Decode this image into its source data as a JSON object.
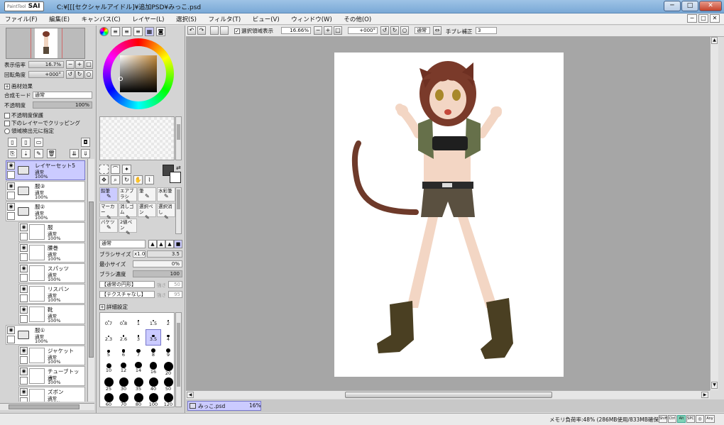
{
  "titlebar": {
    "logo": "SAI",
    "logo_sub": "PaintTool",
    "title": "C:¥[[[セクシャルアイドル]¥追加PSD¥みっこ.psd",
    "min": "─",
    "max": "□",
    "close": "✕"
  },
  "menu": [
    "ファイル(F)",
    "編集(E)",
    "キャンバス(C)",
    "レイヤー(L)",
    "選択(S)",
    "フィルタ(T)",
    "ビュー(V)",
    "ウィンドウ(W)",
    "その他(O)"
  ],
  "navigator": {
    "zoom_label": "表示倍率",
    "zoom_value": "16.7%",
    "angle_label": "回転角度",
    "angle_value": "+000°"
  },
  "layerprops": {
    "texture_label": "画材効果",
    "blend_label": "合成モード",
    "blend_value": "通常",
    "opacity_label": "不透明度",
    "opacity_value": "100%",
    "cb1": "不透明度保護",
    "cb2": "下のレイヤーでクリッピング",
    "cb3": "領域検出元に指定"
  },
  "layers": [
    {
      "name": "レイヤーセット5",
      "mode": "通常",
      "opacity": "100%",
      "folder": true,
      "selected": true,
      "indent": 0
    },
    {
      "name": "服③",
      "mode": "通常",
      "opacity": "100%",
      "folder": true,
      "selected": false,
      "indent": 0
    },
    {
      "name": "服②",
      "mode": "通常",
      "opacity": "100%",
      "folder": true,
      "selected": false,
      "indent": 0
    },
    {
      "name": "服",
      "mode": "通常",
      "opacity": "100%",
      "folder": false,
      "selected": false,
      "indent": 1
    },
    {
      "name": "腰巻",
      "mode": "通常",
      "opacity": "100%",
      "folder": false,
      "selected": false,
      "indent": 1
    },
    {
      "name": "スパッツ",
      "mode": "通常",
      "opacity": "100%",
      "folder": false,
      "selected": false,
      "indent": 1
    },
    {
      "name": "リスバン",
      "mode": "通常",
      "opacity": "100%",
      "folder": false,
      "selected": false,
      "indent": 1
    },
    {
      "name": "靴",
      "mode": "通常",
      "opacity": "100%",
      "folder": false,
      "selected": false,
      "indent": 1
    },
    {
      "name": "服①",
      "mode": "通常",
      "opacity": "100%",
      "folder": true,
      "selected": false,
      "indent": 0
    },
    {
      "name": "ジャケット",
      "mode": "通常",
      "opacity": "100%",
      "folder": false,
      "selected": false,
      "indent": 1
    },
    {
      "name": "チューブトップ",
      "mode": "通常",
      "opacity": "100%",
      "folder": false,
      "selected": false,
      "indent": 1
    },
    {
      "name": "ズボン",
      "mode": "通常",
      "opacity": "100%",
      "folder": false,
      "selected": false,
      "indent": 1
    }
  ],
  "tools": [
    {
      "label": "鉛筆",
      "selected": true
    },
    {
      "label": "エアブラシ",
      "selected": false
    },
    {
      "label": "筆",
      "selected": false
    },
    {
      "label": "水彩筆",
      "selected": false
    },
    {
      "label": "マーカー",
      "selected": false
    },
    {
      "label": "消しゴム",
      "selected": false
    },
    {
      "label": "選択ペン",
      "selected": false
    },
    {
      "label": "選択消し",
      "selected": false
    },
    {
      "label": "バケツ",
      "selected": false
    },
    {
      "label": "2値ペン",
      "selected": false
    }
  ],
  "brush": {
    "mode_value": "通常",
    "size_label": "ブラシサイズ",
    "size_mult": "x1.0",
    "size_value": "3.5",
    "min_label": "最小サイズ",
    "min_value": "0%",
    "density_label": "ブラシ濃度",
    "density_value": "100",
    "shape_value": "【通常の円形】",
    "texture_value": "【テクスチャなし】",
    "strength_label": "強さ",
    "shape_strength": "50",
    "texture_strength": "95",
    "detail_label": "詳細設定"
  },
  "sizes": [
    "0.7",
    "0.8",
    "1",
    "1.5",
    "2",
    "2.3",
    "2.6",
    "3",
    "3.5",
    "4",
    "5",
    "6",
    "7",
    "8",
    "9",
    "10",
    "12",
    "14",
    "16",
    "20",
    "25",
    "30",
    "35",
    "40",
    "50",
    "60",
    "70",
    "80",
    "100",
    "120"
  ],
  "selected_size": "3.5",
  "toptool": {
    "cb_label": "選択領域表示",
    "zoom": "16.66%",
    "angle": "+000°",
    "blend": "通常",
    "stab_label": "手ブレ補正",
    "stab_value": "3"
  },
  "doctab": {
    "name": "みっこ.psd",
    "zoom": "16%"
  },
  "status": {
    "memory": "メモリ負荷率:48% (286MB使用/833MB確保)",
    "keys": [
      "Shift",
      "Ctrl",
      "Alt",
      "SPC",
      "◎",
      "Any"
    ]
  },
  "colors": {
    "accent": "#cbcbff",
    "canvas_bg": "#a6a6a6",
    "hair": "#7a3a2a"
  }
}
